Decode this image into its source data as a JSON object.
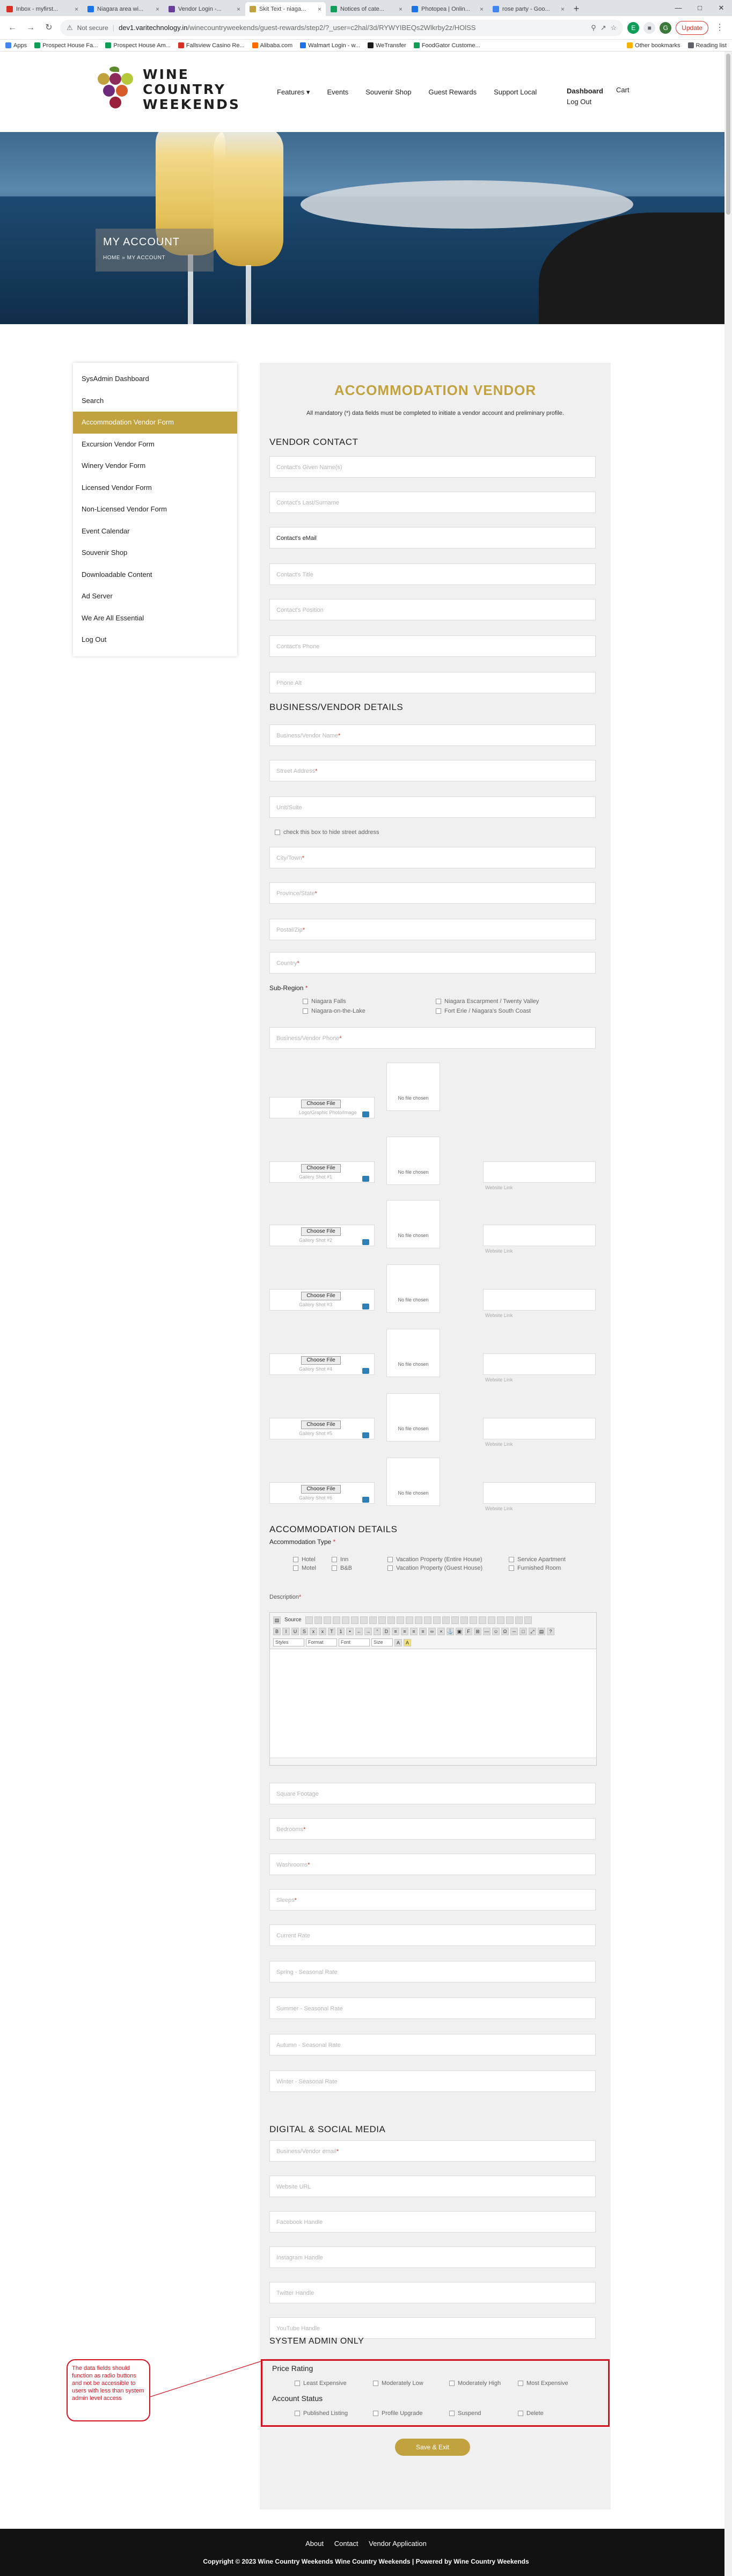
{
  "browser": {
    "tabs": [
      {
        "label": "Inbox - myfirst...",
        "color": "#d93025",
        "active": false
      },
      {
        "label": "Niagara area wi...",
        "color": "#1a73e8",
        "active": false
      },
      {
        "label": "Vendor Login -...",
        "color": "#6a3d9a",
        "active": false
      },
      {
        "label": "Skit Text - niaga...",
        "color": "#c2a23f",
        "active": true
      },
      {
        "label": "Notices of cate...",
        "color": "#0f9d58",
        "active": false
      },
      {
        "label": "Photopea | Onlin...",
        "color": "#1a73e8",
        "active": false
      },
      {
        "label": "rose party - Goo...",
        "color": "#4285f4",
        "active": false
      }
    ],
    "new_tab": "+",
    "not_secure": "Not secure",
    "url_domain": "dev1.varitechnology.in",
    "url_path": "/winecountryweekends/guest-rewards/step2/?_user=c2hal/3d/RYWYIBEQs2Wlkrby2z/HOlSS",
    "update_label": "Update",
    "bookmarks": [
      {
        "label": "Apps",
        "color": "#4285f4"
      },
      {
        "label": "Prospect House Fa...",
        "color": "#0f9d58"
      },
      {
        "label": "Prospect House Am...",
        "color": "#0f9d58"
      },
      {
        "label": "Fallsview Casino Re...",
        "color": "#d93025"
      },
      {
        "label": "Alibaba.com",
        "color": "#ff6a00"
      },
      {
        "label": "Walmart Login - w...",
        "color": "#1a73e8"
      },
      {
        "label": "WeTransfer",
        "color": "#1a1a1a"
      },
      {
        "label": "FoodGator Custome...",
        "color": "#0f9d58"
      }
    ],
    "bookmarks_right": [
      "Other bookmarks",
      "Reading list"
    ]
  },
  "header": {
    "logo_lines": [
      "WINE",
      "COUNTRY",
      "WEEKENDS"
    ],
    "nav": [
      "Features ▾",
      "Events",
      "Souvenir Shop",
      "Guest Rewards",
      "Support Local"
    ],
    "dashboard": "Dashboard",
    "logout": "Log Out",
    "cart": "Cart"
  },
  "hero": {
    "title": "MY ACCOUNT",
    "breadcrumb": "HOME  »  MY ACCOUNT"
  },
  "sidebar": {
    "items": [
      "SysAdmin Dashboard",
      "Search",
      "Accommodation Vendor Form",
      "Excursion Vendor Form",
      "Winery Vendor Form",
      "Licensed Vendor Form",
      "Non-Licensed Vendor Form",
      "Event Calendar",
      "Souvenir Shop",
      "Downloadable Content",
      "Ad Server",
      "We Are All Essential",
      "Log Out"
    ],
    "active_index": 2
  },
  "form": {
    "title": "ACCOMMODATION  VENDOR",
    "note": "All mandatory (*) data fields must be completed to initiate a vendor account and preliminary profile.",
    "sections": {
      "contact": "VENDOR CONTACT",
      "business": "BUSINESS/VENDOR  DETAILS",
      "accommodation": "ACCOMMODATION DETAILS",
      "digital": "DIGITAL & SOCIAL MEDIA",
      "sysadmin": "SYSTEM ADMIN ONLY"
    },
    "contact_fields": [
      "Contact's Given Name(s)",
      "Contact's Last/Surname",
      "Contact's eMail",
      "Contact's Title",
      "Contact's Position",
      "Contact's Phone",
      "Phone Alt"
    ],
    "business_fields_a": [
      "Business/Vendor Name",
      "Street Address",
      "Unit/Suite"
    ],
    "hide_street": "check this box to hide street address",
    "business_fields_b": [
      "City/Town",
      "Province/State",
      "Postal/Zip",
      "Country"
    ],
    "subregion_label": "Sub-Region",
    "subregions": [
      "Niagara Falls",
      "Niagara Escarpment / Twenty Valley",
      "Niagara-on-the-Lake",
      "Fort Erie / Niagara's South Coast"
    ],
    "business_phone": "Business/Vendor Phone",
    "choose_file": "Choose File",
    "logo_caption": "Logo/Graphic Photo/Image",
    "no_file": "No file chosen",
    "gallery_captions": [
      "Gallery Shot #1",
      "Gallery Shot #2",
      "Gallery Shot #3",
      "Gallery Shot #4",
      "Gallery Shot #5",
      "Gallery Shot #6"
    ],
    "website_link": "Website Link",
    "accommodation_type_label": "Accommodation Type",
    "accommodation_types": [
      "Hotel",
      "Motel",
      "Inn",
      "B&B",
      "Vacation Property (Entire House)",
      "Vacation Property (Guest House)",
      "Service Apartment",
      "Furnished Room"
    ],
    "description_label": "Description",
    "editor": {
      "source": "Source",
      "styles": "Styles",
      "format": "Format",
      "font": "Font",
      "size": "Size"
    },
    "accommodation_fields": [
      "Square Footage",
      "Bedrooms",
      "Washrooms",
      "Sleeps",
      "Current Rate",
      "Spring - Seasonal Rate",
      "Summer - Seasonal Rate",
      "Autumn - Seasonal Rate",
      "Winter - Seasonal Rate"
    ],
    "accommodation_required": [
      false,
      true,
      true,
      true,
      false,
      false,
      false,
      false,
      false
    ],
    "digital_fields": [
      "Business/Vendor email",
      "Website URL",
      "Facebook Handle",
      "Instagram Handle",
      "Twitter Handle",
      "YouTube Handle"
    ],
    "digital_required": [
      true,
      false,
      false,
      false,
      false,
      false
    ],
    "price_rating_label": "Price Rating",
    "price_ratings": [
      "Least Expensive",
      "Moderately Low",
      "Moderately High",
      "Most Expensive"
    ],
    "account_status_label": "Account Status",
    "account_statuses": [
      "Published Listing",
      "Profile Upgrade",
      "Suspend",
      "Delete"
    ],
    "save_label": "Save & Exit"
  },
  "annotation": {
    "text": "The data fields should function as radio buttons and not be accessible to users with less than system admin level access"
  },
  "footer": {
    "links": [
      "About",
      "Contact",
      "Vendor Application"
    ],
    "copyright": "Copyright © 2023 Wine Country Weekends Wine Country Weekends | Powered by Wine Country Weekends"
  }
}
